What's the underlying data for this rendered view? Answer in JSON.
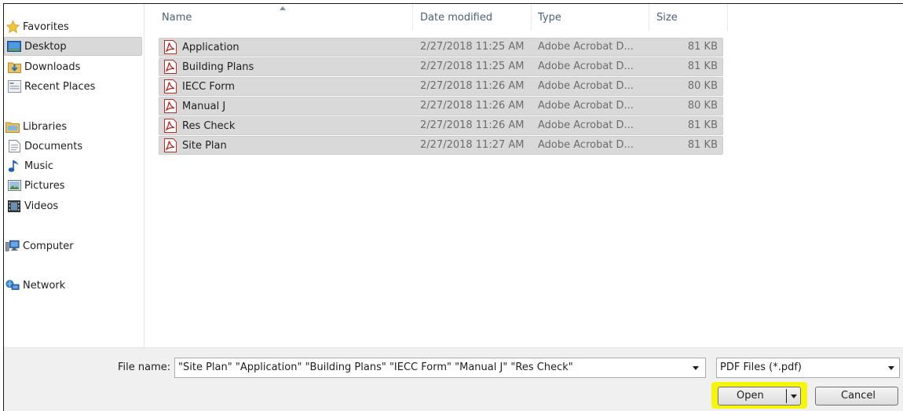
{
  "nav": {
    "favorites": "Favorites",
    "desktop": "Desktop",
    "downloads": "Downloads",
    "recent_places": "Recent Places",
    "libraries": "Libraries",
    "documents": "Documents",
    "music": "Music",
    "pictures": "Pictures",
    "videos": "Videos",
    "computer": "Computer",
    "network": "Network"
  },
  "columns": {
    "name": "Name",
    "date_modified": "Date modified",
    "type": "Type",
    "size": "Size"
  },
  "files": [
    {
      "name": "Application",
      "date": "2/27/2018 11:25 AM",
      "type": "Adobe Acrobat D...",
      "size": "81 KB"
    },
    {
      "name": "Building Plans",
      "date": "2/27/2018 11:25 AM",
      "type": "Adobe Acrobat D...",
      "size": "81 KB"
    },
    {
      "name": "IECC Form",
      "date": "2/27/2018 11:26 AM",
      "type": "Adobe Acrobat D...",
      "size": "80 KB"
    },
    {
      "name": "Manual J",
      "date": "2/27/2018 11:26 AM",
      "type": "Adobe Acrobat D...",
      "size": "80 KB"
    },
    {
      "name": "Res Check",
      "date": "2/27/2018 11:26 AM",
      "type": "Adobe Acrobat D...",
      "size": "81 KB"
    },
    {
      "name": "Site Plan",
      "date": "2/27/2018 11:27 AM",
      "type": "Adobe Acrobat D...",
      "size": "81 KB"
    }
  ],
  "footer": {
    "file_name_label": "File name:",
    "file_name_value": "\"Site Plan\" \"Application\" \"Building Plans\" \"IECC Form\" \"Manual J\" \"Res Check\"",
    "filter_value": "PDF Files (*.pdf)",
    "open_label": "Open",
    "cancel_label": "Cancel"
  },
  "colors": {
    "selection": "#d9d9d9",
    "highlight": "#f6f600",
    "header_text": "#4c607a"
  }
}
